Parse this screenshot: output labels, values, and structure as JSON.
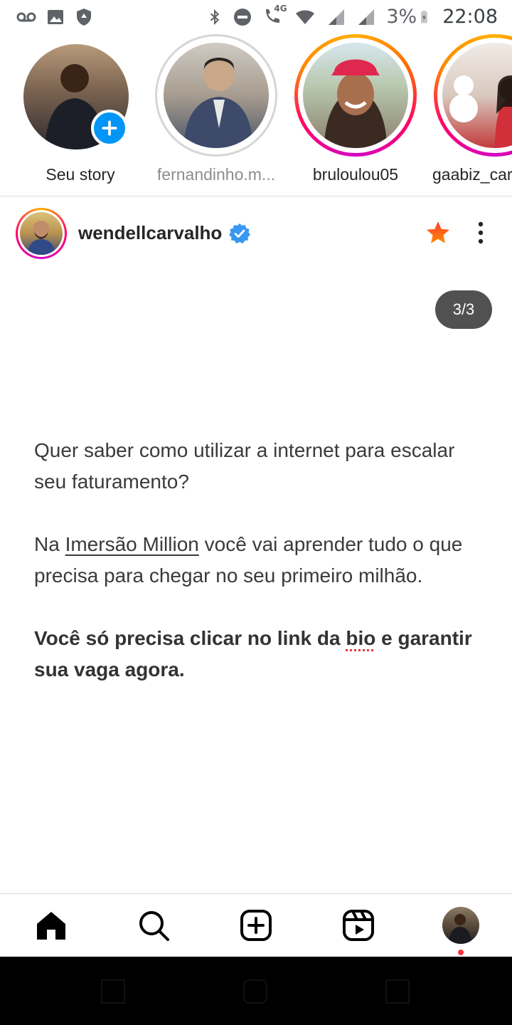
{
  "status_bar": {
    "battery": "3%",
    "time": "22:08",
    "left_icons": [
      "voicemail-icon",
      "image-icon",
      "vpn-shield-icon"
    ],
    "right_icons": [
      "bluetooth-icon",
      "do-not-disturb-icon",
      "volte-call-icon",
      "wifi-icon",
      "signal-icon",
      "signal-icon",
      "battery-icon"
    ],
    "network_label": "4G"
  },
  "stories": [
    {
      "name": "Seu story",
      "seen": false,
      "own": true
    },
    {
      "name": "fernandinho.m...",
      "seen": true
    },
    {
      "name": "bruloulou05",
      "seen": false
    },
    {
      "name": "gaabiz_car",
      "seen": false
    }
  ],
  "post": {
    "username": "wendellcarvalho",
    "verified": true,
    "counter": "3/3",
    "text": {
      "p1": "Quer saber como utilizar a internet para escalar seu faturamento?",
      "p2_before": "Na ",
      "p2_link": "Imersão Million",
      "p2_after": " você vai aprender tudo o que precisa para chegar no seu primeiro milhão.",
      "p3_before": "Você só precisa clicar no link da ",
      "p3_word": "bio",
      "p3_after": " e garantir sua vaga agora."
    }
  },
  "bottom_nav": [
    "home-icon",
    "search-icon",
    "new-post-icon",
    "reels-icon",
    "profile-avatar"
  ],
  "colors": {
    "accent_blue": "#0095f6",
    "favorite_star": "#ff3b30",
    "notification_dot": "#ff3040",
    "text": "#262626"
  }
}
